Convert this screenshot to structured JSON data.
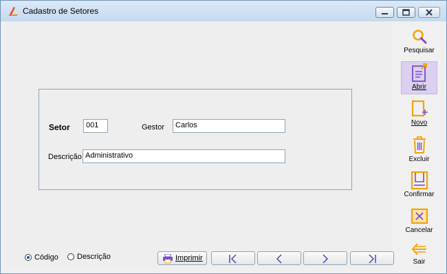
{
  "window": {
    "title": "Cadastro de Setores"
  },
  "form": {
    "setor_label": "Setor",
    "setor_value": "001",
    "gestor_label": "Gestor",
    "gestor_value": "Carlos",
    "descricao_label": "Descrição",
    "descricao_value": "Administrativo"
  },
  "order": {
    "options": [
      "Código",
      "Descrição"
    ],
    "selected": "Código"
  },
  "bottombar": {
    "print_label": "Imprimir"
  },
  "sidebar": {
    "items": [
      {
        "label": "Pesquisar",
        "icon": "search-icon"
      },
      {
        "label": "Abrir",
        "icon": "open-icon"
      },
      {
        "label": "Novo",
        "icon": "new-icon"
      },
      {
        "label": "Excluir",
        "icon": "trash-icon"
      },
      {
        "label": "Confirmar",
        "icon": "save-icon"
      },
      {
        "label": "Cancelar",
        "icon": "cancel-icon"
      },
      {
        "label": "Sair",
        "icon": "exit-icon"
      }
    ],
    "active": "Abrir"
  },
  "colors": {
    "accent": "#f5a300",
    "active_bg": "#dcd0f0",
    "icon_purple": "#7a4bc7"
  }
}
